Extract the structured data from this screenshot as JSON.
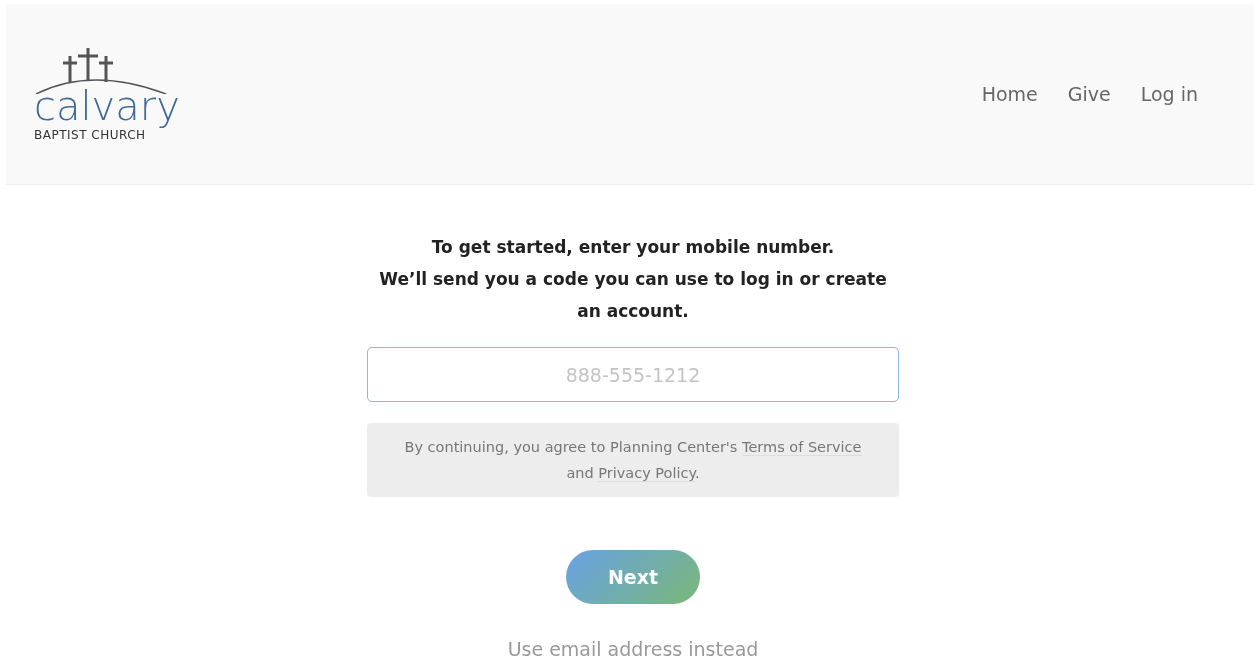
{
  "header": {
    "logo": {
      "name": "calvary",
      "subtitle": "BAPTIST CHURCH"
    },
    "nav": [
      {
        "label": "Home"
      },
      {
        "label": "Give"
      },
      {
        "label": "Log in"
      }
    ]
  },
  "prompt": [
    "To get started, enter your mobile number.",
    "We’ll send you a code you can use to log in or create an account."
  ],
  "phone_field": {
    "placeholder": "888-555-1212"
  },
  "agreement": {
    "before": "By continuing, you agree to Planning Center's ",
    "terms_link": "Terms of Service",
    "middle": " and ",
    "privacy_link": "Privacy Policy",
    "after": "."
  },
  "next_button": "Next",
  "alternate_link": "Use email address instead"
}
